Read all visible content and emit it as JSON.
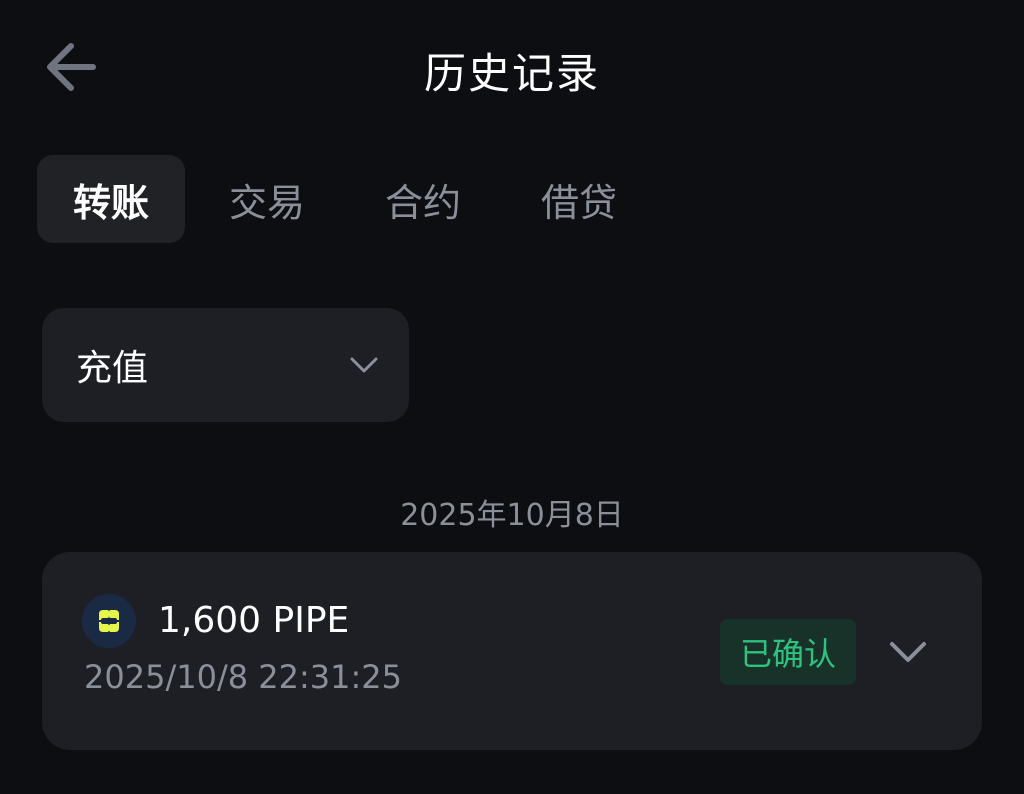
{
  "header": {
    "title": "历史记录",
    "back_icon": "arrow-left-icon"
  },
  "tabs": [
    {
      "label": "转账",
      "active": true
    },
    {
      "label": "交易",
      "active": false
    },
    {
      "label": "合约",
      "active": false
    },
    {
      "label": "借贷",
      "active": false
    }
  ],
  "filter": {
    "selected": "充值",
    "icon": "chevron-down-icon"
  },
  "date_group": "2025年10月8日",
  "transaction": {
    "amount": "1,600 PIPE",
    "datetime": "2025/10/8 22:31:25",
    "status": "已确认",
    "token_icon": "pipe-token-icon",
    "expand_icon": "chevron-down-icon"
  },
  "colors": {
    "background": "#0d0e12",
    "card": "#1e1f24",
    "muted_text": "#8a8f99",
    "success": "#2ec27e",
    "token_accent": "#e6f54a"
  }
}
